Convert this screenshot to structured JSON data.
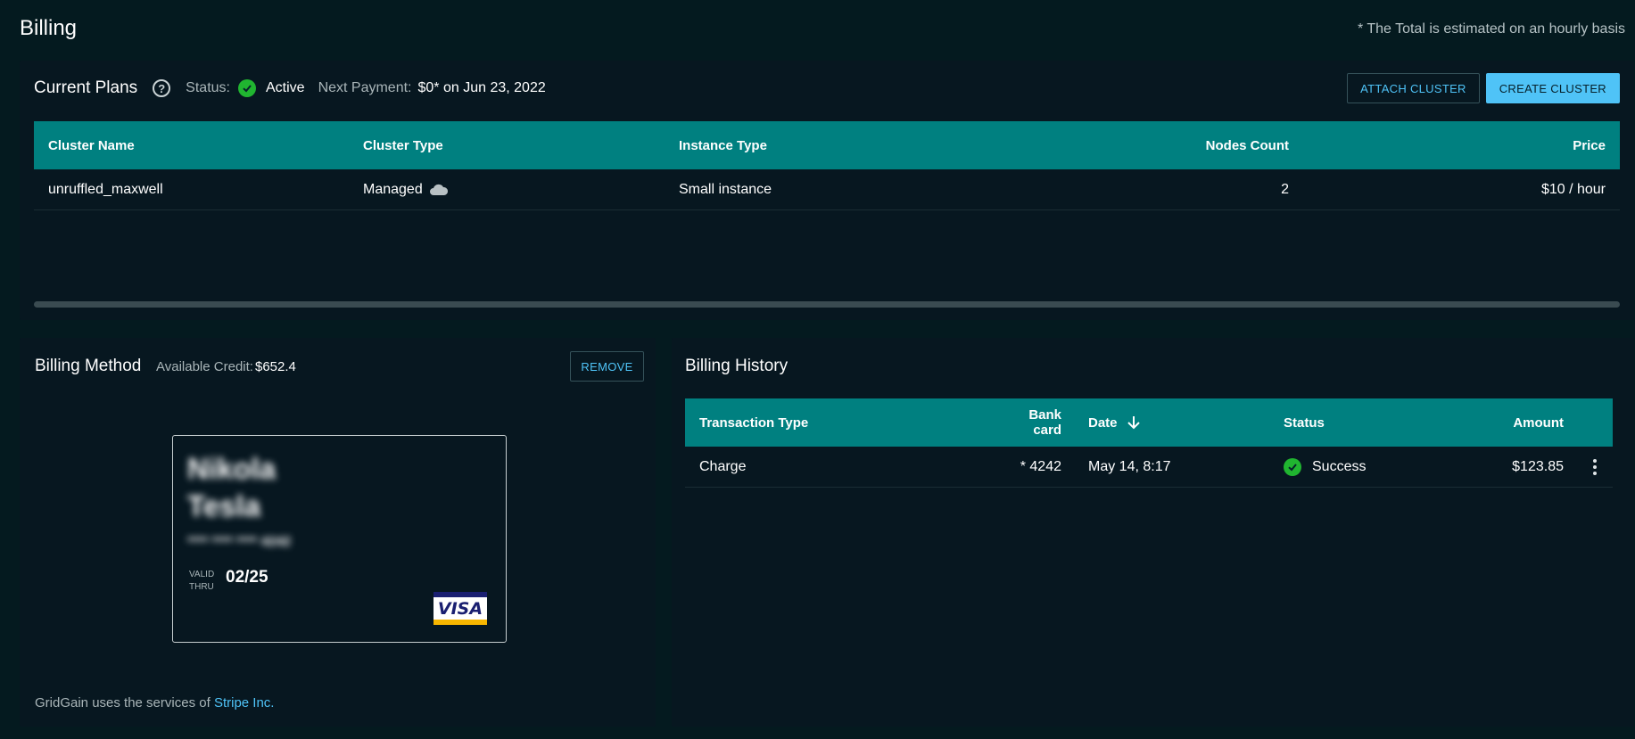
{
  "page": {
    "title": "Billing",
    "note": "* The Total is estimated on an hourly basis"
  },
  "plans": {
    "title": "Current Plans",
    "status_label": "Status:",
    "status_value": "Active",
    "next_payment_label": "Next Payment:",
    "next_payment_value": "$0* on Jun 23, 2022",
    "attach_button": "ATTACH CLUSTER",
    "create_button": "CREATE CLUSTER",
    "columns": [
      "Cluster Name",
      "Cluster Type",
      "Instance Type",
      "Nodes Count",
      "Price"
    ],
    "rows": [
      {
        "name": "unruffled_maxwell",
        "type": "Managed",
        "instance": "Small instance",
        "nodes": "2",
        "price": "$10 / hour"
      }
    ]
  },
  "method": {
    "title": "Billing Method",
    "credit_label": "Available Credit:",
    "credit_value": "$652.4",
    "remove_button": "REMOVE",
    "card": {
      "first_name": "Nikola",
      "last_name": "Tesla",
      "number": "**** **** **** 4242",
      "valid_label_1": "VALID",
      "valid_label_2": "THRU",
      "expiry": "02/25",
      "brand": "VISA"
    },
    "footer_text": "GridGain uses the services of",
    "footer_link": "Stripe Inc."
  },
  "history": {
    "title": "Billing History",
    "columns": [
      "Transaction Type",
      "Bank card",
      "Date",
      "Status",
      "Amount"
    ],
    "rows": [
      {
        "type": "Charge",
        "card": "* 4242",
        "date": "May 14, 8:17",
        "status": "Success",
        "amount": "$123.85"
      }
    ]
  },
  "colors": {
    "background": "#041a1f",
    "panel": "#071720",
    "table_header": "#008080",
    "accent": "#4fc3f7",
    "success": "#20b530"
  }
}
